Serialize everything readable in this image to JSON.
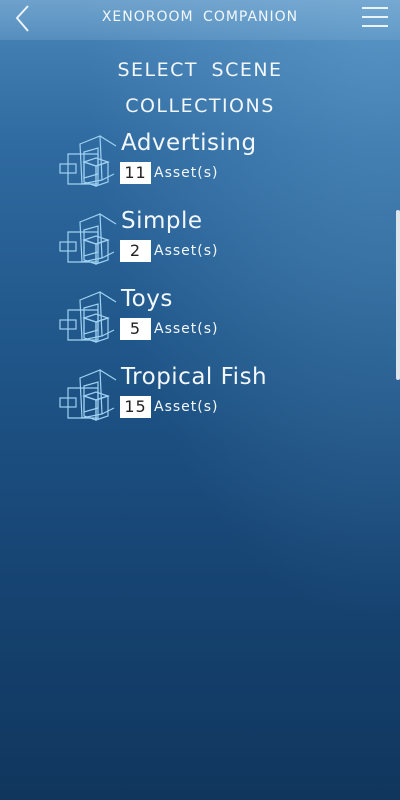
{
  "header": {
    "title": "XENOROOM COMPANION",
    "back_icon": "chevron-left-icon",
    "menu_icon": "hamburger-menu-icon"
  },
  "page": {
    "heading_line1": "SELECT SCENE",
    "heading_line2": "COLLECTIONS"
  },
  "collections": [
    {
      "name": "Advertising",
      "count": "11",
      "unit": "Asset(s)"
    },
    {
      "name": "Simple",
      "count": "2",
      "unit": "Asset(s)"
    },
    {
      "name": "Toys",
      "count": "5",
      "unit": "Asset(s)"
    },
    {
      "name": "Tropical Fish",
      "count": "15",
      "unit": "Asset(s)"
    }
  ],
  "colors": {
    "background_top": "#4a86b9",
    "background_bottom": "#10365d",
    "text": "#f2f7fb",
    "count_box": "#ffffff"
  }
}
